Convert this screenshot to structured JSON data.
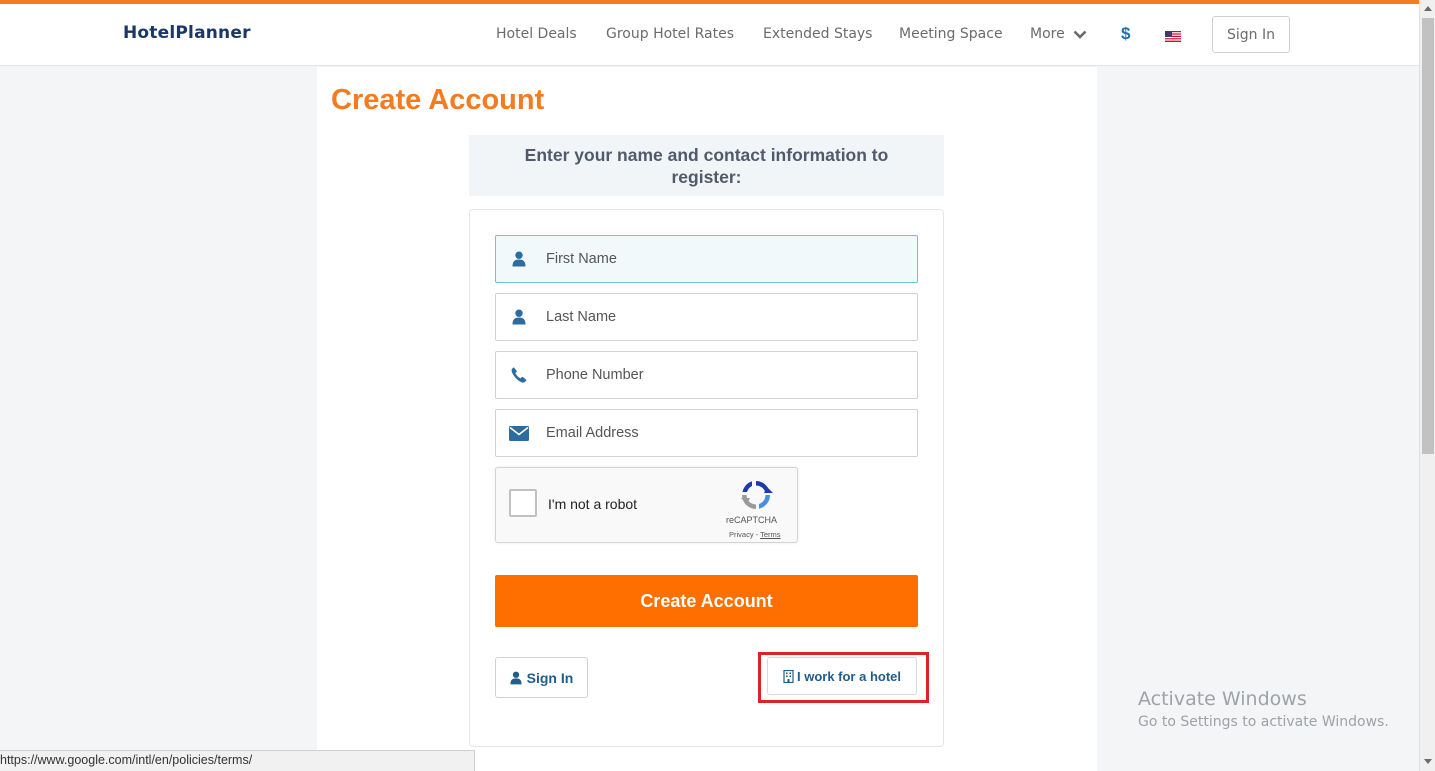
{
  "header": {
    "logo": "HotelPlanner",
    "nav": [
      {
        "label": "Hotel Deals"
      },
      {
        "label": "Group Hotel Rates"
      },
      {
        "label": "Extended Stays"
      },
      {
        "label": "Meeting Space"
      },
      {
        "label": "More"
      }
    ],
    "currency": "$",
    "flag_icon": "us-flag-icon",
    "sign_in": "Sign In"
  },
  "page": {
    "title": "Create Account",
    "instructions": "Enter your name and contact information to register:"
  },
  "form": {
    "first_name": {
      "placeholder": "First Name",
      "value": "",
      "icon": "user-icon"
    },
    "last_name": {
      "placeholder": "Last Name",
      "value": "",
      "icon": "user-icon"
    },
    "phone": {
      "placeholder": "Phone Number",
      "value": "",
      "icon": "phone-icon"
    },
    "email": {
      "placeholder": "Email Address",
      "value": "",
      "icon": "envelope-icon"
    },
    "recaptcha": {
      "label": "I'm not a robot",
      "brand": "reCAPTCHA",
      "privacy": "Privacy",
      "separator": " - ",
      "terms": "Terms"
    },
    "submit": "Create Account",
    "sign_in": "Sign In",
    "hotel_link": "I work for a hotel"
  },
  "colors": {
    "accent": "#f47b20",
    "button": "#ff6f00",
    "link": "#1f5d8c",
    "highlight": "#e0202a"
  },
  "watermark": {
    "title": "Activate Windows",
    "subtitle": "Go to Settings to activate Windows."
  },
  "status_bar": {
    "url": "https://www.google.com/intl/en/policies/terms/"
  }
}
